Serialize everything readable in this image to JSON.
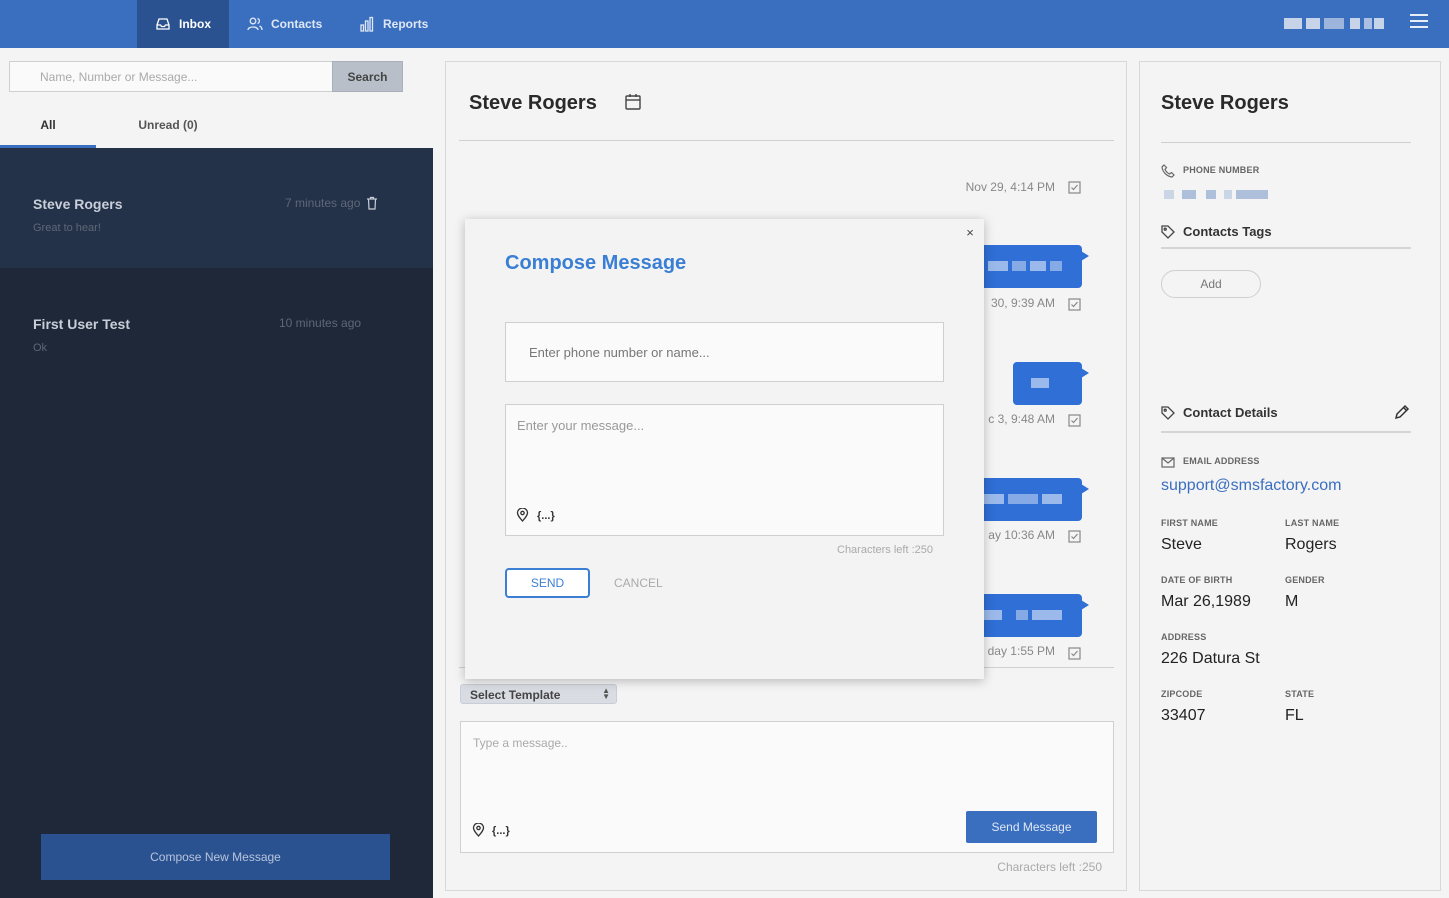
{
  "nav": {
    "tabs": [
      {
        "label": "Inbox",
        "icon": "inbox-icon",
        "active": true
      },
      {
        "label": "Contacts",
        "icon": "users-icon",
        "active": false
      },
      {
        "label": "Reports",
        "icon": "bar-chart-icon",
        "active": false
      }
    ]
  },
  "sidebar": {
    "search_placeholder": "Name, Number or Message...",
    "search_button": "Search",
    "filters": [
      {
        "label": "All",
        "active": true
      },
      {
        "label": "Unread (0)",
        "active": false
      }
    ],
    "conversations": [
      {
        "name": "Steve Rogers",
        "time": "7 minutes ago",
        "preview": "Great to hear!"
      },
      {
        "name": "First User Test",
        "time": "10 minutes ago",
        "preview": "Ok"
      }
    ],
    "compose_button": "Compose New Message"
  },
  "conversation": {
    "title": "Steve Rogers",
    "timestamps": [
      "Nov 29, 4:14 PM",
      "30, 9:39 AM",
      "c 3, 9:48 AM",
      "ay 10:36 AM",
      "day 1:55 PM"
    ],
    "template_select": "Select Template",
    "message_placeholder": "Type a message..",
    "variables_label": "{...}",
    "send_button": "Send Message",
    "chars_left": "Characters left :250"
  },
  "contact": {
    "name": "Steve Rogers",
    "phone_label": "PHONE NUMBER",
    "tags_label": "Contacts Tags",
    "add_button": "Add",
    "details_label": "Contact Details",
    "email_label": "EMAIL ADDRESS",
    "email": "support@smsfactory.com",
    "first_name_label": "FIRST NAME",
    "first_name": "Steve",
    "last_name_label": "LAST NAME",
    "last_name": "Rogers",
    "dob_label": "DATE OF BIRTH",
    "dob": "Mar 26,1989",
    "gender_label": "GENDER",
    "gender": "M",
    "address_label": "ADDRESS",
    "address": "226 Datura St",
    "zip_label": "ZIPCODE",
    "zip": "33407",
    "state_label": "STATE",
    "state": "FL"
  },
  "modal": {
    "close": "×",
    "title": "Compose Message",
    "phone_placeholder": "Enter phone number or name...",
    "message_placeholder": "Enter your message...",
    "variables_label": "{...}",
    "chars_left": "Characters left :250",
    "send_button": "SEND",
    "cancel_button": "CANCEL"
  },
  "colors": {
    "nav": "#3a6fc0",
    "nav_active": "#2b5290",
    "sidebar_bg": "#1e2838",
    "bubble": "#2f6fd6",
    "accent": "#3a7fd4"
  }
}
